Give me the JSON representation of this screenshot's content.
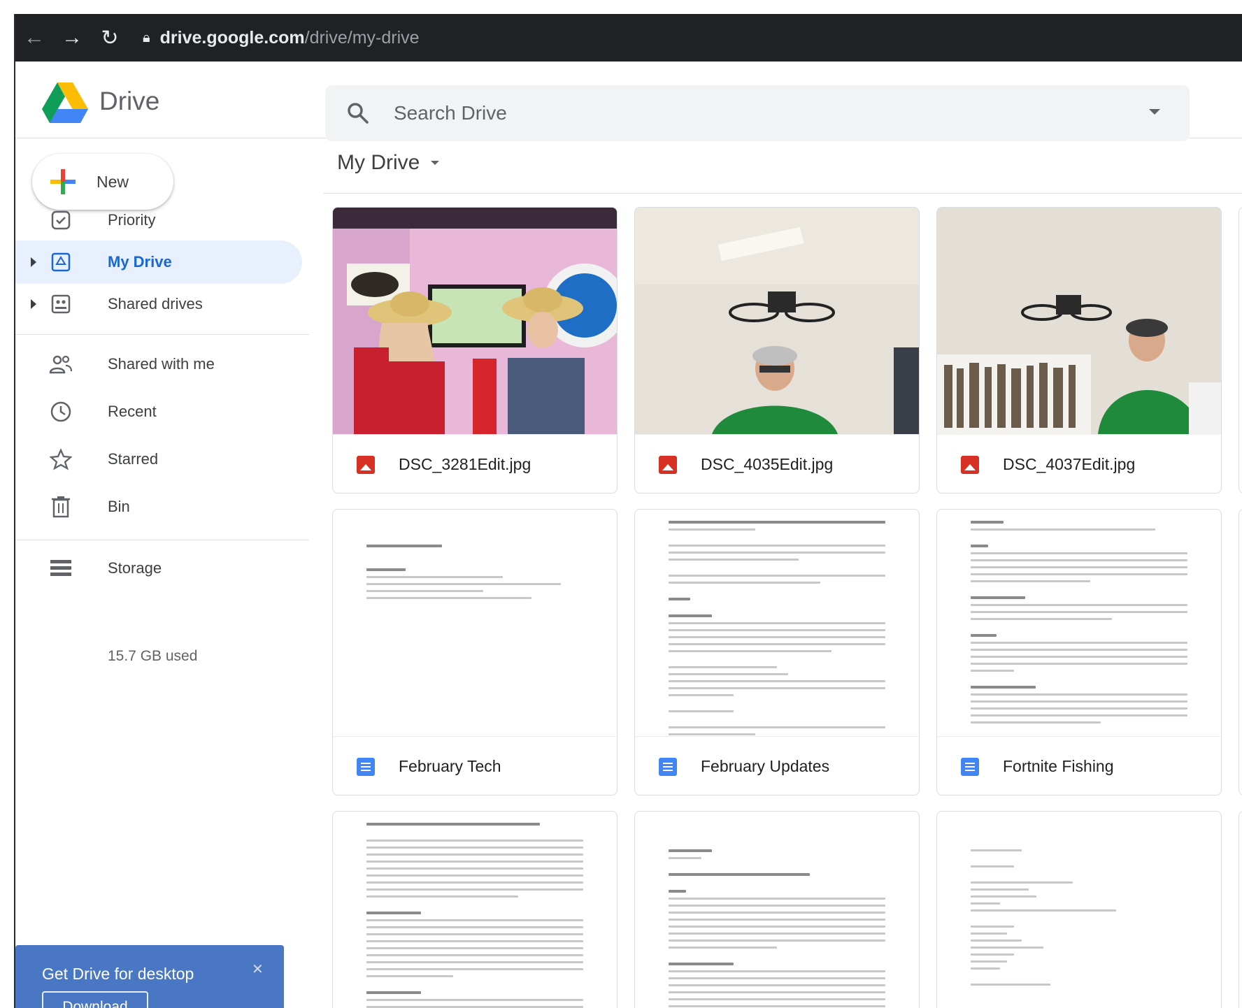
{
  "browser": {
    "url_host": "drive.google.com",
    "url_path": "/drive/my-drive"
  },
  "header": {
    "brand": "Drive",
    "search_placeholder": "Search Drive"
  },
  "sidebar": {
    "new_label": "New",
    "items": [
      {
        "label": "Priority",
        "icon": "priority-icon"
      },
      {
        "label": "My Drive",
        "icon": "my-drive-icon",
        "active": true
      },
      {
        "label": "Shared drives",
        "icon": "shared-drives-icon"
      },
      {
        "label": "Shared with me",
        "icon": "shared-with-me-icon"
      },
      {
        "label": "Recent",
        "icon": "clock-icon"
      },
      {
        "label": "Starred",
        "icon": "star-icon"
      },
      {
        "label": "Bin",
        "icon": "bin-icon"
      },
      {
        "label": "Storage",
        "icon": "storage-icon"
      }
    ],
    "storage_used": "15.7 GB used"
  },
  "promo": {
    "title": "Get Drive for desktop",
    "button": "Download"
  },
  "main": {
    "title": "My Drive",
    "files": [
      {
        "name": "DSC_3281Edit.jpg",
        "type": "image"
      },
      {
        "name": "DSC_4035Edit.jpg",
        "type": "image"
      },
      {
        "name": "DSC_4037Edit.jpg",
        "type": "image"
      },
      {
        "name": "February Tech",
        "type": "doc"
      },
      {
        "name": "February Updates",
        "type": "doc"
      },
      {
        "name": "Fortnite Fishing",
        "type": "doc"
      }
    ]
  },
  "colors": {
    "accent": "#1967d2",
    "active_bg": "#e8f0fe",
    "promo_bg": "#4a77c4",
    "image_file": "#d93025",
    "doc_file": "#4285f4"
  }
}
